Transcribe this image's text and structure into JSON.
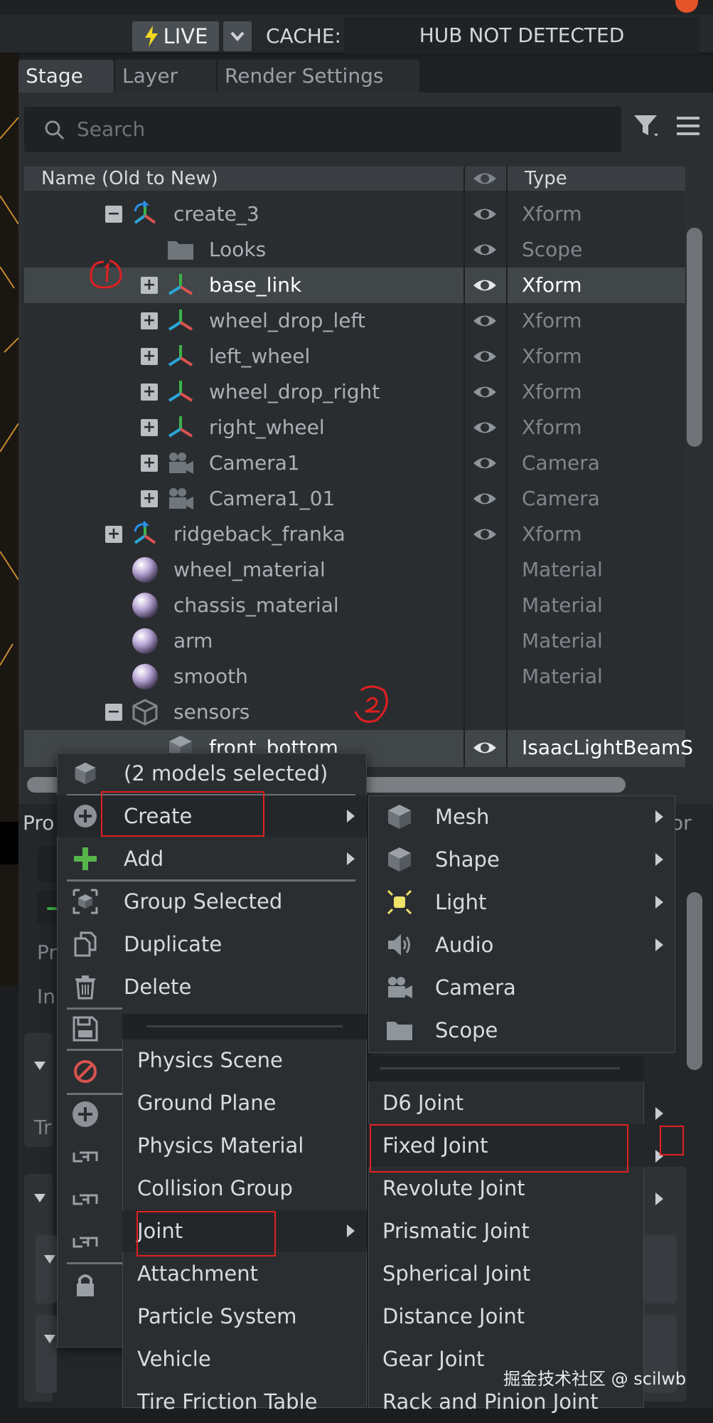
{
  "topbar": {
    "live_label": "LIVE",
    "cache_label": "CACHE:",
    "hub_status": "HUB NOT DETECTED"
  },
  "tabs": [
    {
      "label": "Stage"
    },
    {
      "label": "Layer"
    },
    {
      "label": "Render Settings"
    }
  ],
  "search": {
    "placeholder": "Search"
  },
  "tree_header": {
    "name_col": "Name (Old to New)",
    "type_col": "Type"
  },
  "tree_rows": [
    {
      "name": "create_3",
      "type": "Xform",
      "icon": "xform-reference-icon",
      "expander": "collapse"
    },
    {
      "name": "Looks",
      "type": "Scope",
      "icon": "folder-icon",
      "expander": "none"
    },
    {
      "name": "base_link",
      "type": "Xform",
      "icon": "xform-icon",
      "expander": "expand",
      "selected": true
    },
    {
      "name": "wheel_drop_left",
      "type": "Xform",
      "icon": "xform-icon",
      "expander": "expand"
    },
    {
      "name": "left_wheel",
      "type": "Xform",
      "icon": "xform-icon",
      "expander": "expand"
    },
    {
      "name": "wheel_drop_right",
      "type": "Xform",
      "icon": "xform-icon",
      "expander": "expand"
    },
    {
      "name": "right_wheel",
      "type": "Xform",
      "icon": "xform-icon",
      "expander": "expand"
    },
    {
      "name": "Camera1",
      "type": "Camera",
      "icon": "camera-icon",
      "expander": "expand"
    },
    {
      "name": "Camera1_01",
      "type": "Camera",
      "icon": "camera-icon",
      "expander": "expand"
    },
    {
      "name": "ridgeback_franka",
      "type": "Xform",
      "icon": "xform-reference-icon",
      "expander": "expand"
    },
    {
      "name": "wheel_material",
      "type": "Material",
      "icon": "material-sphere-icon",
      "expander": "none"
    },
    {
      "name": "chassis_material",
      "type": "Material",
      "icon": "material-sphere-icon",
      "expander": "none"
    },
    {
      "name": "arm",
      "type": "Material",
      "icon": "material-sphere-icon",
      "expander": "none"
    },
    {
      "name": "smooth",
      "type": "Material",
      "icon": "material-sphere-icon",
      "expander": "none"
    },
    {
      "name": "sensors",
      "type": "",
      "icon": "box-outline-icon",
      "expander": "collapse"
    },
    {
      "name": "front_bottom",
      "type": "IsaacLightBeamS",
      "icon": "cube-icon",
      "expander": "none",
      "selected": true
    }
  ],
  "property_panel": {
    "title_partial": "Pro",
    "right_partial": "or",
    "pr_partial": "Pr",
    "in_partial": "In",
    "tr_partial": "Tr"
  },
  "context_menu": {
    "header": "(2 models selected)",
    "items": [
      {
        "label": "Create",
        "icon": "plus-circle-icon",
        "submenu": true
      },
      {
        "label": "Add",
        "icon": "plus-icon",
        "submenu": true
      },
      {
        "label": "Group Selected",
        "icon": "group-icon"
      },
      {
        "label": "Duplicate",
        "icon": "duplicate-icon"
      },
      {
        "label": "Delete",
        "icon": "trash-icon"
      }
    ]
  },
  "physics_menu": {
    "items": [
      {
        "label": "Physics Scene"
      },
      {
        "label": "Ground Plane"
      },
      {
        "label": "Physics Material"
      },
      {
        "label": "Collision Group"
      },
      {
        "label": "Joint",
        "submenu": true
      },
      {
        "label": "Attachment"
      },
      {
        "label": "Particle System"
      },
      {
        "label": "Vehicle"
      },
      {
        "label": "Tire Friction Table"
      }
    ]
  },
  "create_menu": {
    "items": [
      {
        "label": "Mesh",
        "icon": "mesh-cube-icon",
        "submenu": true
      },
      {
        "label": "Shape",
        "icon": "shape-cube-icon",
        "submenu": true
      },
      {
        "label": "Light",
        "icon": "light-icon",
        "submenu": true
      },
      {
        "label": "Audio",
        "icon": "audio-icon",
        "submenu": true
      },
      {
        "label": "Camera",
        "icon": "camera-icon",
        "submenu": false
      },
      {
        "label": "Scope",
        "icon": "folder-icon",
        "submenu": false
      }
    ]
  },
  "joint_menu": {
    "items": [
      {
        "label": "D6 Joint"
      },
      {
        "label": "Fixed Joint"
      },
      {
        "label": "Revolute Joint"
      },
      {
        "label": "Prismatic Joint"
      },
      {
        "label": "Spherical Joint"
      },
      {
        "label": "Distance Joint"
      },
      {
        "label": "Gear Joint"
      },
      {
        "label": "Rack and Pinion Joint"
      }
    ]
  },
  "watermark": "掘金技术社区 @ scilwb",
  "colors": {
    "background": "#2c2f32",
    "selection": "#414649",
    "annotation_red": "#e02020",
    "accent_orange": "#e5532a"
  }
}
